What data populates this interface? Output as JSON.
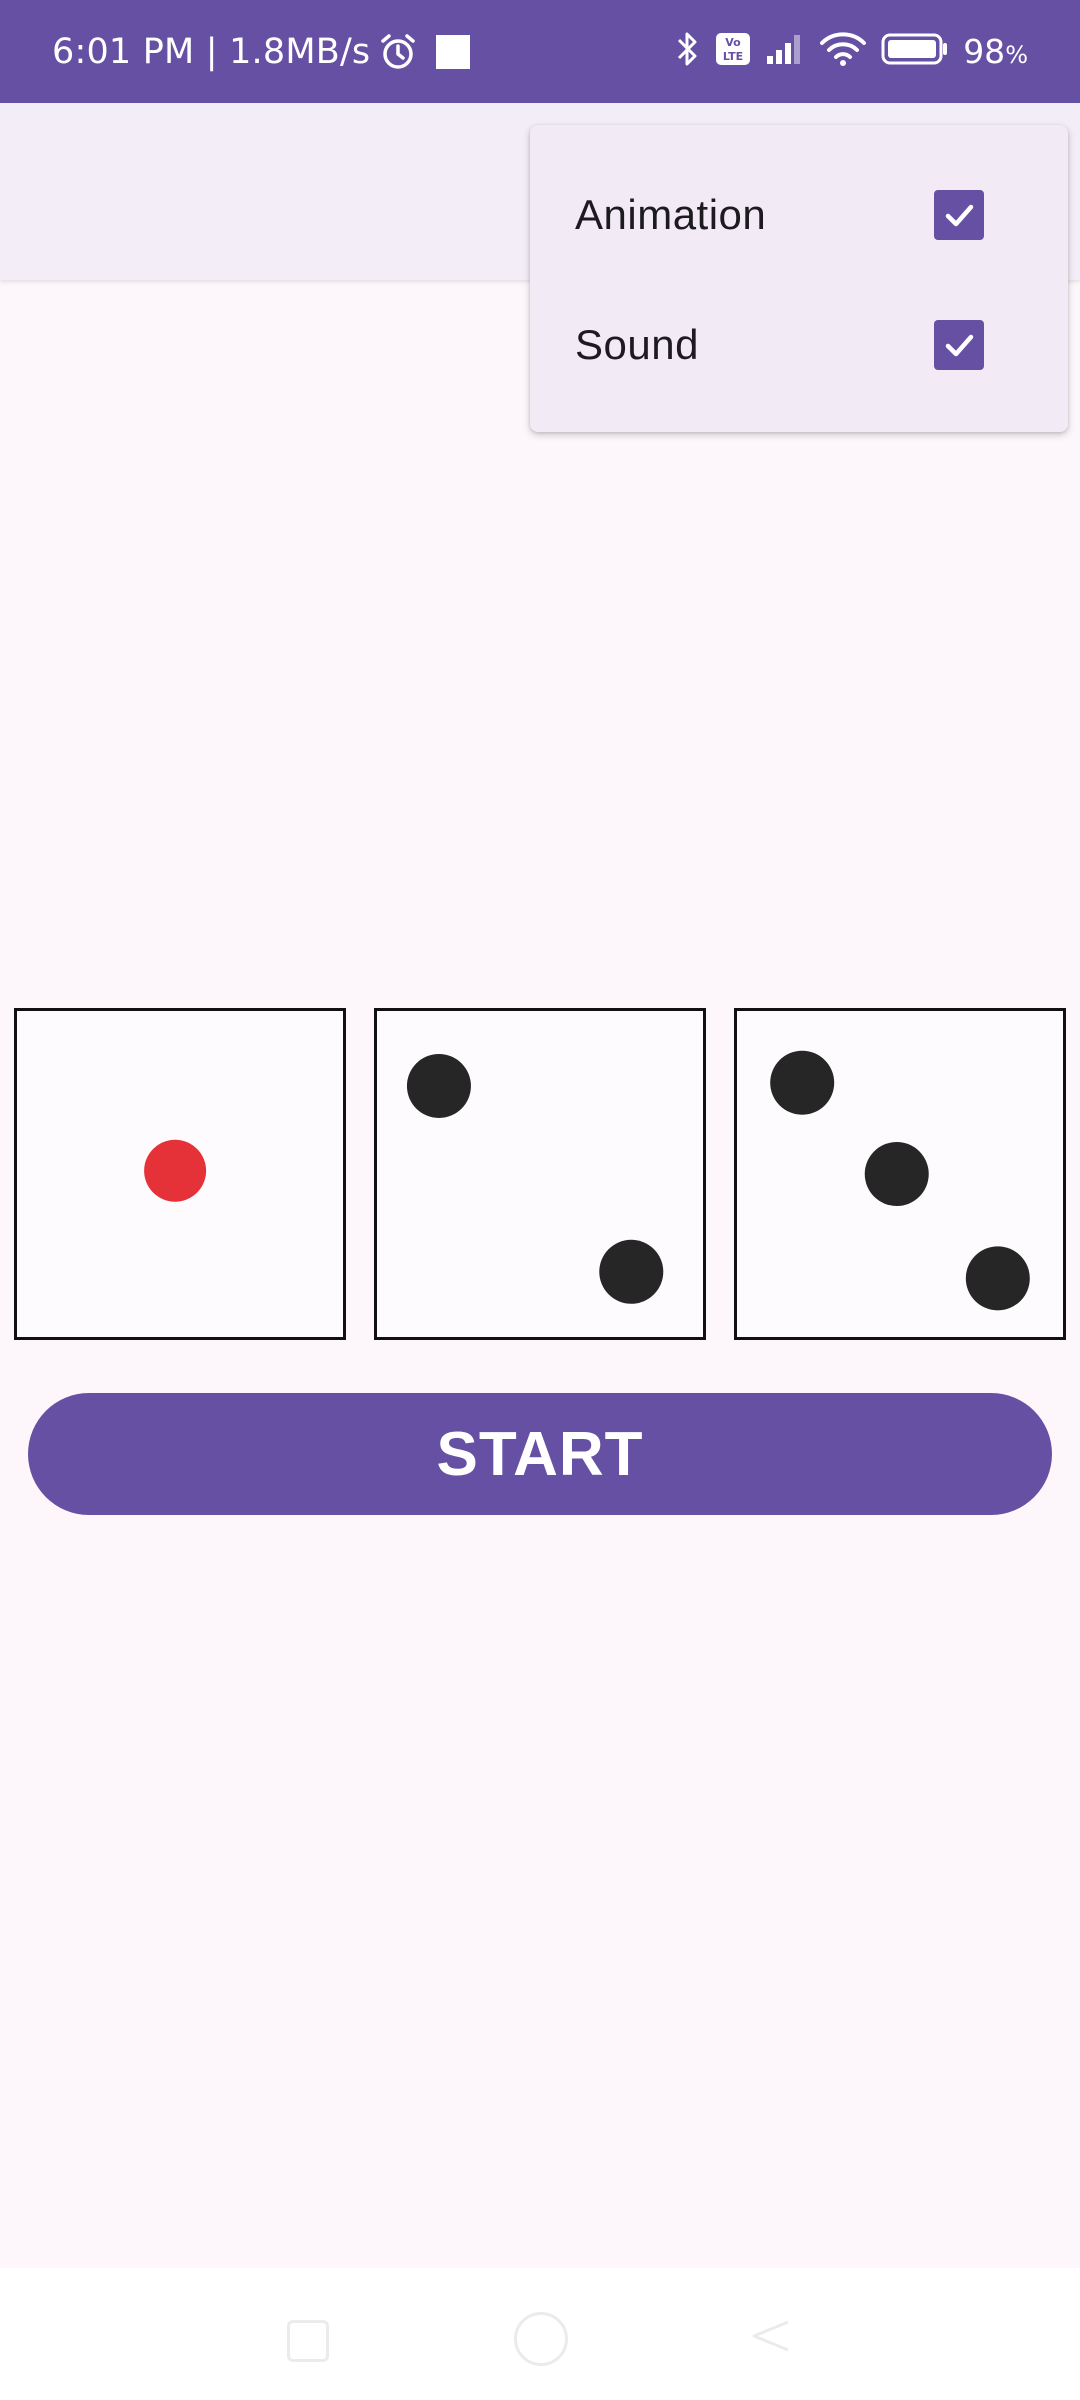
{
  "status_bar": {
    "time_speed": "6:01 PM | 1.8MB/s",
    "battery_percent": "98",
    "battery_unit": "%",
    "icons": [
      "alarm-icon",
      "notification-square-icon",
      "bluetooth-icon",
      "volte-icon",
      "signal-icon",
      "wifi-icon",
      "battery-icon"
    ]
  },
  "menu": {
    "items": [
      {
        "label": "Animation",
        "checked": true
      },
      {
        "label": "Sound",
        "checked": true
      }
    ]
  },
  "dice": [
    {
      "value": 1,
      "pip_color": "#E53238"
    },
    {
      "value": 2,
      "pip_color": "#262626"
    },
    {
      "value": 3,
      "pip_color": "#262626"
    }
  ],
  "start_button": {
    "label": "START"
  },
  "colors": {
    "primary": "#6650A4",
    "background": "#FDF7FC",
    "app_bar": "#F3EDF7",
    "menu_surface": "#F2EBF5"
  }
}
